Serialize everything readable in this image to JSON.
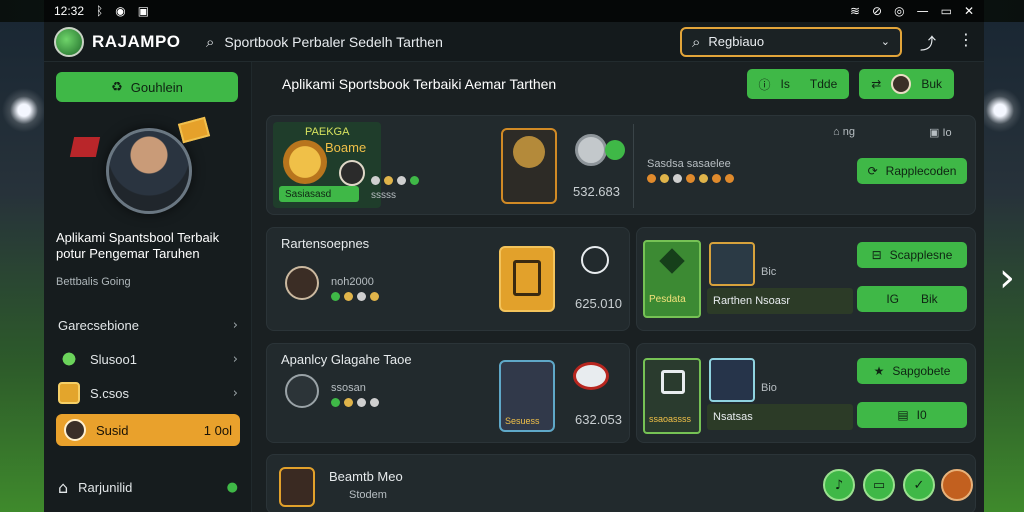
{
  "statusbar": {
    "time": "12:32",
    "left_icons": [
      "bluetooth-icon",
      "shield-icon",
      "image-icon"
    ],
    "right_icons": [
      "wifi-icon",
      "vpn-icon",
      "signal-icon",
      "battery-icon",
      "close-icon"
    ]
  },
  "header": {
    "app_name": "RAJAMPO",
    "search_placeholder": "Sportbook Perbaler Sedelh Tarthen",
    "dropdown_value": "Regbiauo"
  },
  "sidebar": {
    "cta_label": "Gouhlein",
    "hero_title": "Aplikami Spantsbool Terbaik potur Pengemar Taruhen",
    "hero_sub": "Bettbalis Going",
    "section_title": "Garecsebione",
    "items": [
      {
        "label": "Slusoo1",
        "icon": "trophy-icon"
      },
      {
        "label": "S.csos",
        "icon": "gold-icon"
      }
    ],
    "active_item": {
      "label": "Susid",
      "right": "1 0ol"
    },
    "footer_label": "Rarjunilid"
  },
  "main": {
    "title": "Aplikami Sportsbook Terbaiki Aemar Tarthen",
    "top_buttons": [
      {
        "label": "Is",
        "sub": "Tdde"
      },
      {
        "label": "Buk"
      }
    ],
    "card1": {
      "label_a": "PAEKGA",
      "label_b": "Boame",
      "badge": "Sasiasasd",
      "number": "532.683",
      "stats": "Sasdsa sasaelee",
      "right_a": "ng",
      "right_b": "Io",
      "button": "Rapplecoden",
      "tile_label": "sssss"
    },
    "card2": {
      "title": "Rartensoepnes",
      "row": "noh2000",
      "number": "625.010",
      "green_label": "Pesdata",
      "strip": "Rarthen Nsoasr",
      "right_sub": "Bic",
      "button1": "Scapplesne",
      "button2_a": "IG",
      "button2_b": "Bik"
    },
    "card3": {
      "title": "Apanlcy Glagahe Taoe",
      "row": "ssosan",
      "number": "632.053",
      "tile_label": "Sesuess",
      "strip": "ssaoassss",
      "right_sub": "Bio",
      "strip2": "Nsatsas",
      "button1": "Sapgobete",
      "button2": "I0"
    },
    "card4": {
      "name": "Beamtb Meo",
      "sub": "Stodem"
    }
  },
  "colors": {
    "accent_green": "#3fb847",
    "accent_gold": "#e9a12c",
    "panel": "#222a2d"
  }
}
